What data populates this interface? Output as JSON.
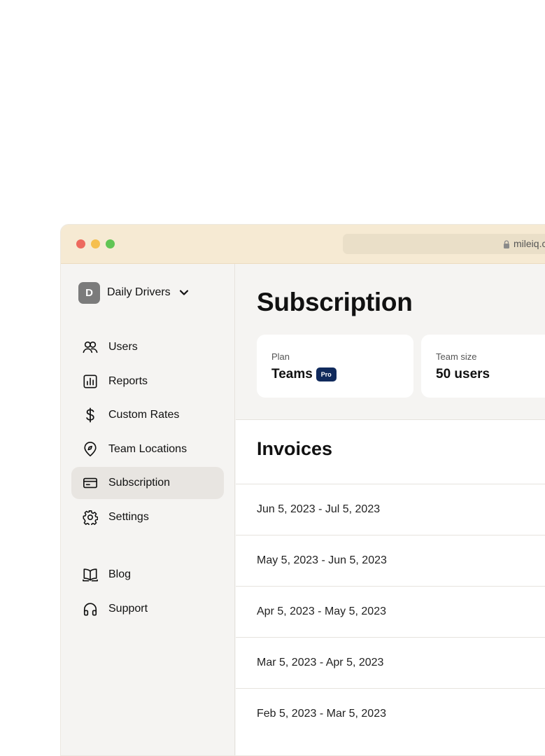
{
  "browser": {
    "url": "mileiq.c"
  },
  "org": {
    "initial": "D",
    "name": "Daily Drivers"
  },
  "nav": [
    {
      "label": "Users",
      "icon": "users-icon"
    },
    {
      "label": "Reports",
      "icon": "reports-icon"
    },
    {
      "label": "Custom Rates",
      "icon": "dollar-icon"
    },
    {
      "label": "Team Locations",
      "icon": "location-pin-icon"
    },
    {
      "label": "Subscription",
      "icon": "credit-card-icon",
      "active": true
    },
    {
      "label": "Settings",
      "icon": "gear-icon"
    }
  ],
  "nav_secondary": [
    {
      "label": "Blog",
      "icon": "book-icon"
    },
    {
      "label": "Support",
      "icon": "headphones-icon"
    }
  ],
  "page": {
    "title": "Subscription"
  },
  "plan": {
    "label": "Plan",
    "value": "Teams",
    "badge": "Pro"
  },
  "team": {
    "label": "Team size",
    "value": "50 users"
  },
  "invoices": {
    "title": "Invoices",
    "rows": [
      "Jun 5, 2023 - Jul 5, 2023",
      "May 5, 2023 - Jun 5, 2023",
      "Apr 5, 2023 - May 5, 2023",
      "Mar 5, 2023 - Apr 5, 2023",
      "Feb 5, 2023 - Mar 5, 2023"
    ]
  },
  "colors": {
    "titlebar": "#f6ead3",
    "badge": "#102a5c",
    "active_nav": "#e8e5e1"
  }
}
